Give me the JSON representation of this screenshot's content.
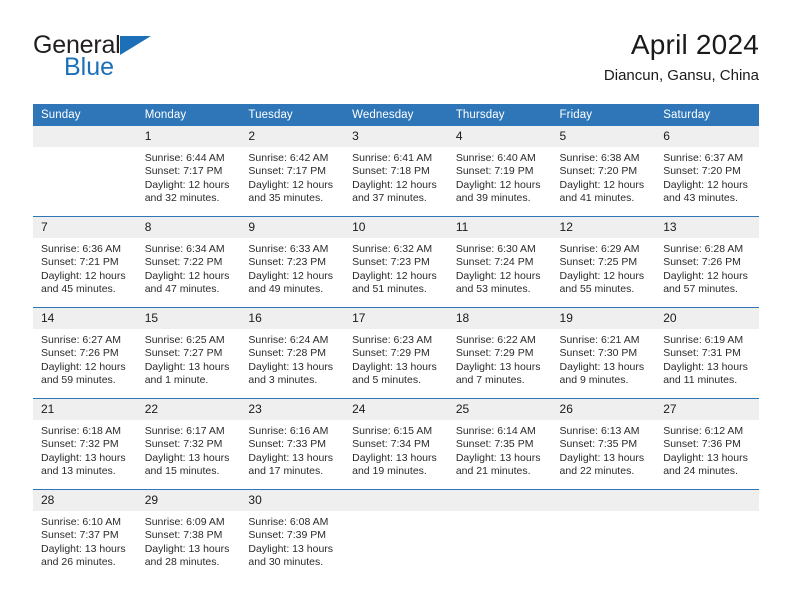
{
  "branding": {
    "logo_text_primary": "General",
    "logo_text_secondary": "Blue",
    "accent_color": "#1d70b7"
  },
  "header": {
    "title": "April 2024",
    "subtitle": "Diancun, Gansu, China"
  },
  "theme": {
    "header_bar_color": "#2e76b8",
    "daynum_strip_color": "#efefef",
    "week_separator_color": "#2e76b8",
    "text_color": "#1a1a1a"
  },
  "weekday_headers": [
    "Sunday",
    "Monday",
    "Tuesday",
    "Wednesday",
    "Thursday",
    "Friday",
    "Saturday"
  ],
  "weeks": [
    [
      {
        "day": "",
        "lines": []
      },
      {
        "day": "1",
        "lines": [
          "Sunrise: 6:44 AM",
          "Sunset: 7:17 PM",
          "Daylight: 12 hours",
          "and 32 minutes."
        ]
      },
      {
        "day": "2",
        "lines": [
          "Sunrise: 6:42 AM",
          "Sunset: 7:17 PM",
          "Daylight: 12 hours",
          "and 35 minutes."
        ]
      },
      {
        "day": "3",
        "lines": [
          "Sunrise: 6:41 AM",
          "Sunset: 7:18 PM",
          "Daylight: 12 hours",
          "and 37 minutes."
        ]
      },
      {
        "day": "4",
        "lines": [
          "Sunrise: 6:40 AM",
          "Sunset: 7:19 PM",
          "Daylight: 12 hours",
          "and 39 minutes."
        ]
      },
      {
        "day": "5",
        "lines": [
          "Sunrise: 6:38 AM",
          "Sunset: 7:20 PM",
          "Daylight: 12 hours",
          "and 41 minutes."
        ]
      },
      {
        "day": "6",
        "lines": [
          "Sunrise: 6:37 AM",
          "Sunset: 7:20 PM",
          "Daylight: 12 hours",
          "and 43 minutes."
        ]
      }
    ],
    [
      {
        "day": "7",
        "lines": [
          "Sunrise: 6:36 AM",
          "Sunset: 7:21 PM",
          "Daylight: 12 hours",
          "and 45 minutes."
        ]
      },
      {
        "day": "8",
        "lines": [
          "Sunrise: 6:34 AM",
          "Sunset: 7:22 PM",
          "Daylight: 12 hours",
          "and 47 minutes."
        ]
      },
      {
        "day": "9",
        "lines": [
          "Sunrise: 6:33 AM",
          "Sunset: 7:23 PM",
          "Daylight: 12 hours",
          "and 49 minutes."
        ]
      },
      {
        "day": "10",
        "lines": [
          "Sunrise: 6:32 AM",
          "Sunset: 7:23 PM",
          "Daylight: 12 hours",
          "and 51 minutes."
        ]
      },
      {
        "day": "11",
        "lines": [
          "Sunrise: 6:30 AM",
          "Sunset: 7:24 PM",
          "Daylight: 12 hours",
          "and 53 minutes."
        ]
      },
      {
        "day": "12",
        "lines": [
          "Sunrise: 6:29 AM",
          "Sunset: 7:25 PM",
          "Daylight: 12 hours",
          "and 55 minutes."
        ]
      },
      {
        "day": "13",
        "lines": [
          "Sunrise: 6:28 AM",
          "Sunset: 7:26 PM",
          "Daylight: 12 hours",
          "and 57 minutes."
        ]
      }
    ],
    [
      {
        "day": "14",
        "lines": [
          "Sunrise: 6:27 AM",
          "Sunset: 7:26 PM",
          "Daylight: 12 hours",
          "and 59 minutes."
        ]
      },
      {
        "day": "15",
        "lines": [
          "Sunrise: 6:25 AM",
          "Sunset: 7:27 PM",
          "Daylight: 13 hours",
          "and 1 minute."
        ]
      },
      {
        "day": "16",
        "lines": [
          "Sunrise: 6:24 AM",
          "Sunset: 7:28 PM",
          "Daylight: 13 hours",
          "and 3 minutes."
        ]
      },
      {
        "day": "17",
        "lines": [
          "Sunrise: 6:23 AM",
          "Sunset: 7:29 PM",
          "Daylight: 13 hours",
          "and 5 minutes."
        ]
      },
      {
        "day": "18",
        "lines": [
          "Sunrise: 6:22 AM",
          "Sunset: 7:29 PM",
          "Daylight: 13 hours",
          "and 7 minutes."
        ]
      },
      {
        "day": "19",
        "lines": [
          "Sunrise: 6:21 AM",
          "Sunset: 7:30 PM",
          "Daylight: 13 hours",
          "and 9 minutes."
        ]
      },
      {
        "day": "20",
        "lines": [
          "Sunrise: 6:19 AM",
          "Sunset: 7:31 PM",
          "Daylight: 13 hours",
          "and 11 minutes."
        ]
      }
    ],
    [
      {
        "day": "21",
        "lines": [
          "Sunrise: 6:18 AM",
          "Sunset: 7:32 PM",
          "Daylight: 13 hours",
          "and 13 minutes."
        ]
      },
      {
        "day": "22",
        "lines": [
          "Sunrise: 6:17 AM",
          "Sunset: 7:32 PM",
          "Daylight: 13 hours",
          "and 15 minutes."
        ]
      },
      {
        "day": "23",
        "lines": [
          "Sunrise: 6:16 AM",
          "Sunset: 7:33 PM",
          "Daylight: 13 hours",
          "and 17 minutes."
        ]
      },
      {
        "day": "24",
        "lines": [
          "Sunrise: 6:15 AM",
          "Sunset: 7:34 PM",
          "Daylight: 13 hours",
          "and 19 minutes."
        ]
      },
      {
        "day": "25",
        "lines": [
          "Sunrise: 6:14 AM",
          "Sunset: 7:35 PM",
          "Daylight: 13 hours",
          "and 21 minutes."
        ]
      },
      {
        "day": "26",
        "lines": [
          "Sunrise: 6:13 AM",
          "Sunset: 7:35 PM",
          "Daylight: 13 hours",
          "and 22 minutes."
        ]
      },
      {
        "day": "27",
        "lines": [
          "Sunrise: 6:12 AM",
          "Sunset: 7:36 PM",
          "Daylight: 13 hours",
          "and 24 minutes."
        ]
      }
    ],
    [
      {
        "day": "28",
        "lines": [
          "Sunrise: 6:10 AM",
          "Sunset: 7:37 PM",
          "Daylight: 13 hours",
          "and 26 minutes."
        ]
      },
      {
        "day": "29",
        "lines": [
          "Sunrise: 6:09 AM",
          "Sunset: 7:38 PM",
          "Daylight: 13 hours",
          "and 28 minutes."
        ]
      },
      {
        "day": "30",
        "lines": [
          "Sunrise: 6:08 AM",
          "Sunset: 7:39 PM",
          "Daylight: 13 hours",
          "and 30 minutes."
        ]
      },
      {
        "day": "",
        "lines": []
      },
      {
        "day": "",
        "lines": []
      },
      {
        "day": "",
        "lines": []
      },
      {
        "day": "",
        "lines": []
      }
    ]
  ]
}
